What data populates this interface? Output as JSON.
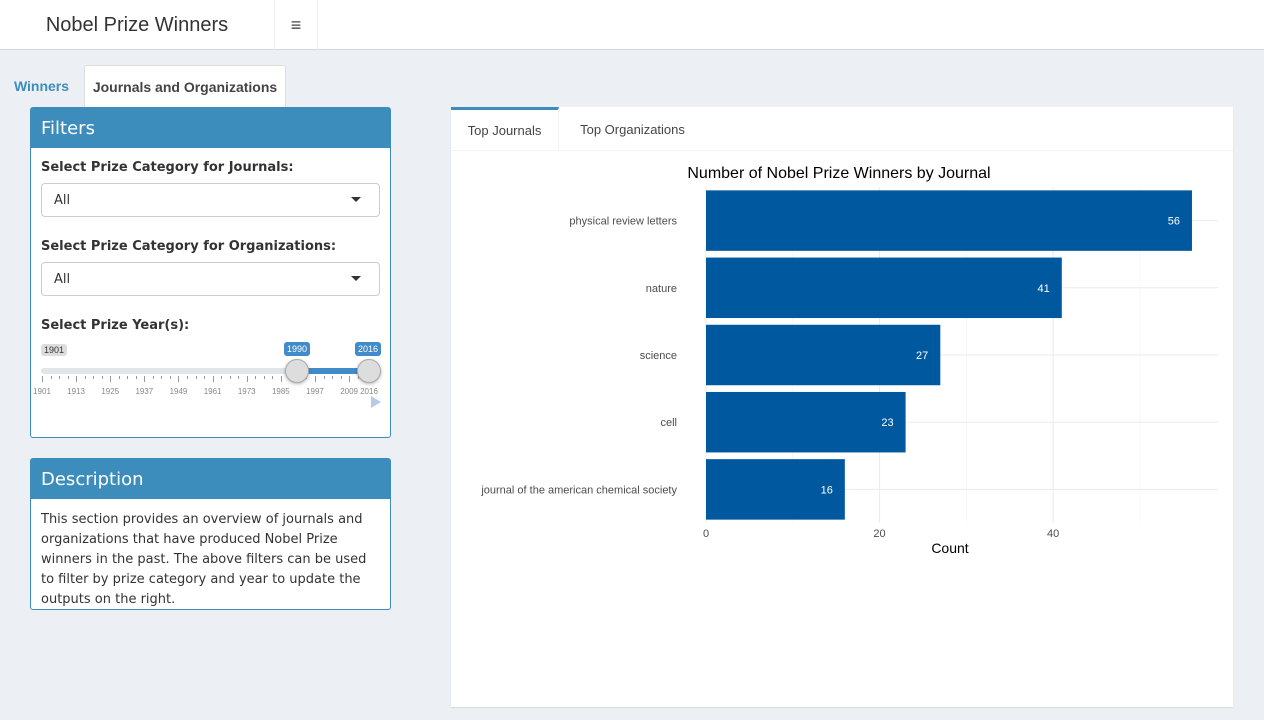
{
  "app": {
    "title": "Nobel Prize Winners",
    "menu_icon": "hamburger-icon",
    "menu_glyph": "≡"
  },
  "nav": {
    "tabs": [
      {
        "label": "Winners"
      },
      {
        "label": "Journals and Organizations"
      }
    ]
  },
  "filters": {
    "title": "Filters",
    "journal_label": "Select Prize Category for Journals:",
    "journal_value": "All",
    "org_label": "Select Prize Category for Organizations:",
    "org_value": "All",
    "year_label": "Select Prize Year(s):",
    "year_min": "1901",
    "year_from": "1990",
    "year_to": "2016",
    "ticks": [
      "1901",
      "1913",
      "1925",
      "1937",
      "1949",
      "1961",
      "1973",
      "1985",
      "1997",
      "2009",
      "2016"
    ]
  },
  "description": {
    "title": "Description",
    "text": "This section provides an overview of journals and organizations that have produced Nobel Prize winners in the past. The above filters can be used to filter by prize category and year to update the outputs on the right."
  },
  "panel": {
    "tabs": [
      {
        "label": "Top Journals"
      },
      {
        "label": "Top Organizations"
      }
    ]
  },
  "colors": {
    "accent": "#3c8dbc",
    "bar": "#00589f",
    "slider": "#428bca"
  },
  "chart_data": {
    "type": "bar",
    "orientation": "horizontal",
    "title": "Number of Nobel Prize Winners by Journal",
    "xlabel": "Count",
    "ylabel": "",
    "categories": [
      "physical review letters",
      "nature",
      "science",
      "cell",
      "journal of the american chemical society"
    ],
    "values": [
      56,
      41,
      27,
      23,
      16
    ],
    "xlim": [
      0,
      59
    ],
    "xticks": [
      0,
      20,
      40
    ],
    "grid": true
  }
}
